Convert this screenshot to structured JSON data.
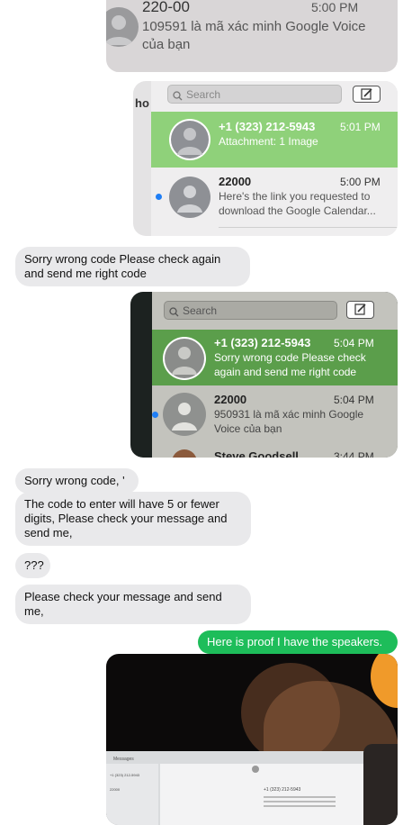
{
  "shot1": {
    "sender": "220-00",
    "time": "5:00 PM",
    "preview": "109591 là mã xác minh Google Voice của bạn"
  },
  "shot2": {
    "side_label": "ho",
    "search_placeholder": "Search",
    "rows": [
      {
        "name": "+1 (323) 212-5943",
        "time": "5:01 PM",
        "preview": "Attachment: 1 Image"
      },
      {
        "name": "22000",
        "time": "5:00 PM",
        "preview": "Here's the link you requested to download the Google Calendar..."
      }
    ]
  },
  "msg1": "Sorry wrong code Please check again and send me right code",
  "shot3": {
    "search_placeholder": "Search",
    "rows": [
      {
        "name": "+1 (323) 212-5943",
        "time": "5:04 PM",
        "preview": "Sorry wrong code Please check again and send me right code"
      },
      {
        "name": "22000",
        "time": "5:04 PM",
        "preview": "950931 là mã xác minh Google Voice của bạn"
      },
      {
        "name": "Steve Goodsell",
        "time": "3:44 PM"
      }
    ]
  },
  "messages": [
    "Sorry wrong code, '",
    "The code to enter will have 5 or fewer digits, Please check your message and send me,",
    "???",
    "Please check your message and send me,"
  ],
  "outgoing": "Here is proof I have the speakers.",
  "photo": {
    "app_label": "Messages",
    "row1": "+1 (323) 212-5943",
    "row2": "22000",
    "row3": "+1 (323) 212-5943"
  },
  "colors": {
    "incoming_bubble": "#e9e9eb",
    "outgoing_bubble": "#1ebd5a",
    "selected_row": "#8fd17a"
  }
}
